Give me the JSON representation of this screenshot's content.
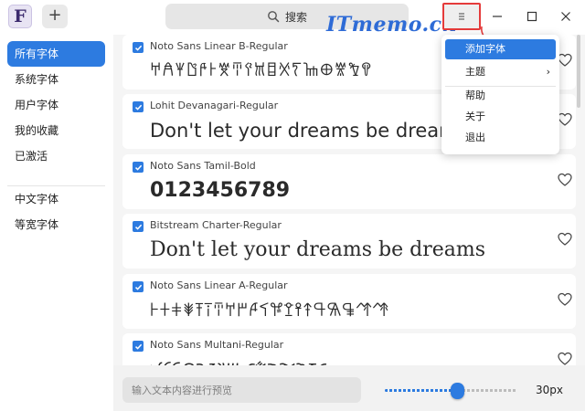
{
  "titlebar": {
    "logo_letter": "F",
    "add_label": "+",
    "search_label": "搜索",
    "watermark": "ITmemo.cn"
  },
  "sidebar": {
    "items": [
      {
        "label": "所有字体",
        "active": true
      },
      {
        "label": "系统字体"
      },
      {
        "label": "用户字体"
      },
      {
        "label": "我的收藏"
      },
      {
        "label": "已激活"
      },
      {
        "label": "中文字体"
      },
      {
        "label": "等宽字体"
      }
    ]
  },
  "fonts": [
    {
      "name": "Noto Sans Linear B-Regular",
      "preview": "𐀀𐀁𐀂𐀃𐀄𐀅𐀆𐀇𐀈𐀉𐀊𐀋𐀍𐀎𐀏𐀐𐀑𐀒",
      "checked": true
    },
    {
      "name": "Lohit Devanagari-Regular",
      "preview": "Don't let your dreams be dreams",
      "checked": true
    },
    {
      "name": "Noto Sans Tamil-Bold",
      "preview": "0123456789",
      "checked": true
    },
    {
      "name": "Bitstream Charter-Regular",
      "preview": "Don't let your dreams be dreams",
      "checked": true
    },
    {
      "name": "Noto Sans Linear A-Regular",
      "preview": "𐘀𐘁𐘂𐘃𐘄𐘅𐘆𐘇𐘈𐘉𐘊𐘋𐘌𐘍𐘎𐘏𐘐𐘑𐘒𐘓",
      "checked": true
    },
    {
      "name": "Noto Sans Multani-Regular",
      "preview": "𑊀𑊁𑊂𑊃𑊄𑊅𑊆𑊈𑊊𑊋𑊌𑊍𑊏𑊐𑊑",
      "checked": true
    }
  ],
  "bottombar": {
    "preview_placeholder": "输入文本内容进行预览",
    "size_value": 30,
    "size_label": "30px"
  },
  "menu": {
    "items": [
      {
        "label": "添加字体",
        "highlighted": true
      },
      {
        "label": "主题",
        "submenu": true,
        "submenu_arrow": "›"
      },
      {
        "label": "帮助"
      },
      {
        "label": "关于"
      },
      {
        "label": "退出"
      }
    ]
  },
  "colors": {
    "accent": "#2d7be0",
    "annotation": "#e53b3b",
    "watermark": "#2e6bd6"
  }
}
